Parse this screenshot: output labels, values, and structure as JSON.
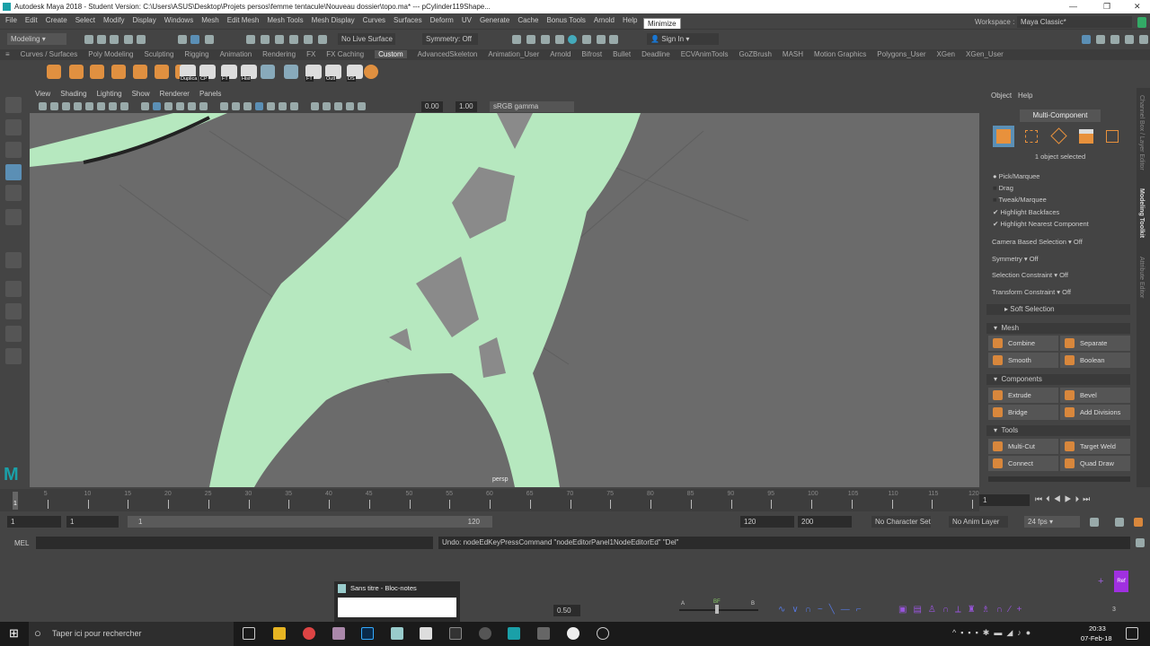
{
  "window": {
    "title": "Autodesk Maya 2018 - Student Version: C:\\Users\\ASUS\\Desktop\\Projets persos\\femme tentacule\\Nouveau dossier\\topo.ma*  ---  pCylinder119Shape...",
    "tooltip": "Minimize",
    "min": "—",
    "max": "❐",
    "close": "✕"
  },
  "menu": [
    "File",
    "Edit",
    "Create",
    "Select",
    "Modify",
    "Display",
    "Windows",
    "Mesh",
    "Edit Mesh",
    "Mesh Tools",
    "Mesh Display",
    "Curves",
    "Surfaces",
    "Deform",
    "UV",
    "Generate",
    "Cache",
    "Bonus Tools",
    "Arnold",
    "Help"
  ],
  "status": {
    "mode": "Modeling",
    "live_surface": "No Live Surface",
    "symmetry": "Symmetry: Off",
    "sign_in": "Sign In",
    "workspace_label": "Workspace :",
    "workspace": "Maya Classic*"
  },
  "shelf_tabs": [
    "Curves / Surfaces",
    "Poly Modeling",
    "Sculpting",
    "Rigging",
    "Animation",
    "Rendering",
    "FX",
    "FX Caching",
    "Custom",
    "AdvancedSkeleton",
    "Animation_User",
    "Arnold",
    "Bifrost",
    "Bullet",
    "Deadline",
    "ECVAnimTools",
    "GoZBrush",
    "MASH",
    "Motion Graphics",
    "Polygons_User",
    "XGen",
    "XGen_User"
  ],
  "shelf_labels": [
    "Duplica",
    "CP",
    "FT",
    "Hist",
    "FT",
    "Outl",
    "DS"
  ],
  "panel_menu": [
    "View",
    "Shading",
    "Lighting",
    "Show",
    "Renderer",
    "Panels"
  ],
  "panel_toolbar": {
    "exposure": "0.00",
    "gamma": "1.00",
    "color_space": "sRGB gamma"
  },
  "viewport": {
    "camera": "persp",
    "mesh_color": "#b6e8bf"
  },
  "right_panel": {
    "menu": [
      "Object",
      "Help"
    ],
    "mode": "Multi-Component",
    "selected": "1 object selected",
    "pick_options": [
      "Pick/Marquee",
      "Drag",
      "Tweak/Marquee"
    ],
    "checks": [
      "Highlight Backfaces",
      "Highlight Nearest Component"
    ],
    "options": [
      {
        "label": "Camera Based Selection",
        "value": "Off"
      },
      {
        "label": "Symmetry",
        "value": "Off"
      },
      {
        "label": "Selection Constraint",
        "value": "Off"
      },
      {
        "label": "Transform Constraint",
        "value": "Off"
      }
    ],
    "soft_selection": "Soft Selection",
    "sections": [
      {
        "title": "Mesh",
        "buttons": [
          "Combine",
          "Separate",
          "Smooth",
          "Boolean"
        ]
      },
      {
        "title": "Components",
        "buttons": [
          "Extrude",
          "Bevel",
          "Bridge",
          "Add Divisions"
        ]
      },
      {
        "title": "Tools",
        "buttons": [
          "Multi-Cut",
          "Target Weld",
          "Connect",
          "Quad Draw"
        ]
      }
    ],
    "side_tabs": [
      "Channel Box / Layer Editor",
      "Modeling Toolkit",
      "Attribute Editor"
    ]
  },
  "timeline": {
    "ticks": [
      "5",
      "10",
      "15",
      "20",
      "25",
      "30",
      "35",
      "40",
      "45",
      "50",
      "55",
      "60",
      "65",
      "70",
      "75",
      "80",
      "85",
      "90",
      "95",
      "100",
      "105",
      "110",
      "115",
      "120"
    ],
    "current": "1",
    "current_field": "1"
  },
  "range": {
    "start": "1",
    "start2": "1",
    "slider_start": "1",
    "slider_end": "120",
    "end": "120",
    "end2": "200",
    "character_set": "No Character Set",
    "anim_layer": "No Anim Layer",
    "fps": "24 fps"
  },
  "mel": {
    "label": "MEL",
    "feedback": "Undo: nodeEdKeyPressCommand \"nodeEditorPanel1NodeEditorEd\" \"Del\""
  },
  "lower": {
    "ref": "Ref",
    "value": "0.50",
    "a": "A",
    "bf": "BF",
    "b": "B",
    "count": "3"
  },
  "notepad_preview": "Sans titre - Bloc-notes",
  "taskbar": {
    "search": "Taper ici pour rechercher",
    "time": "20:33",
    "date": "07-Feb-18"
  }
}
